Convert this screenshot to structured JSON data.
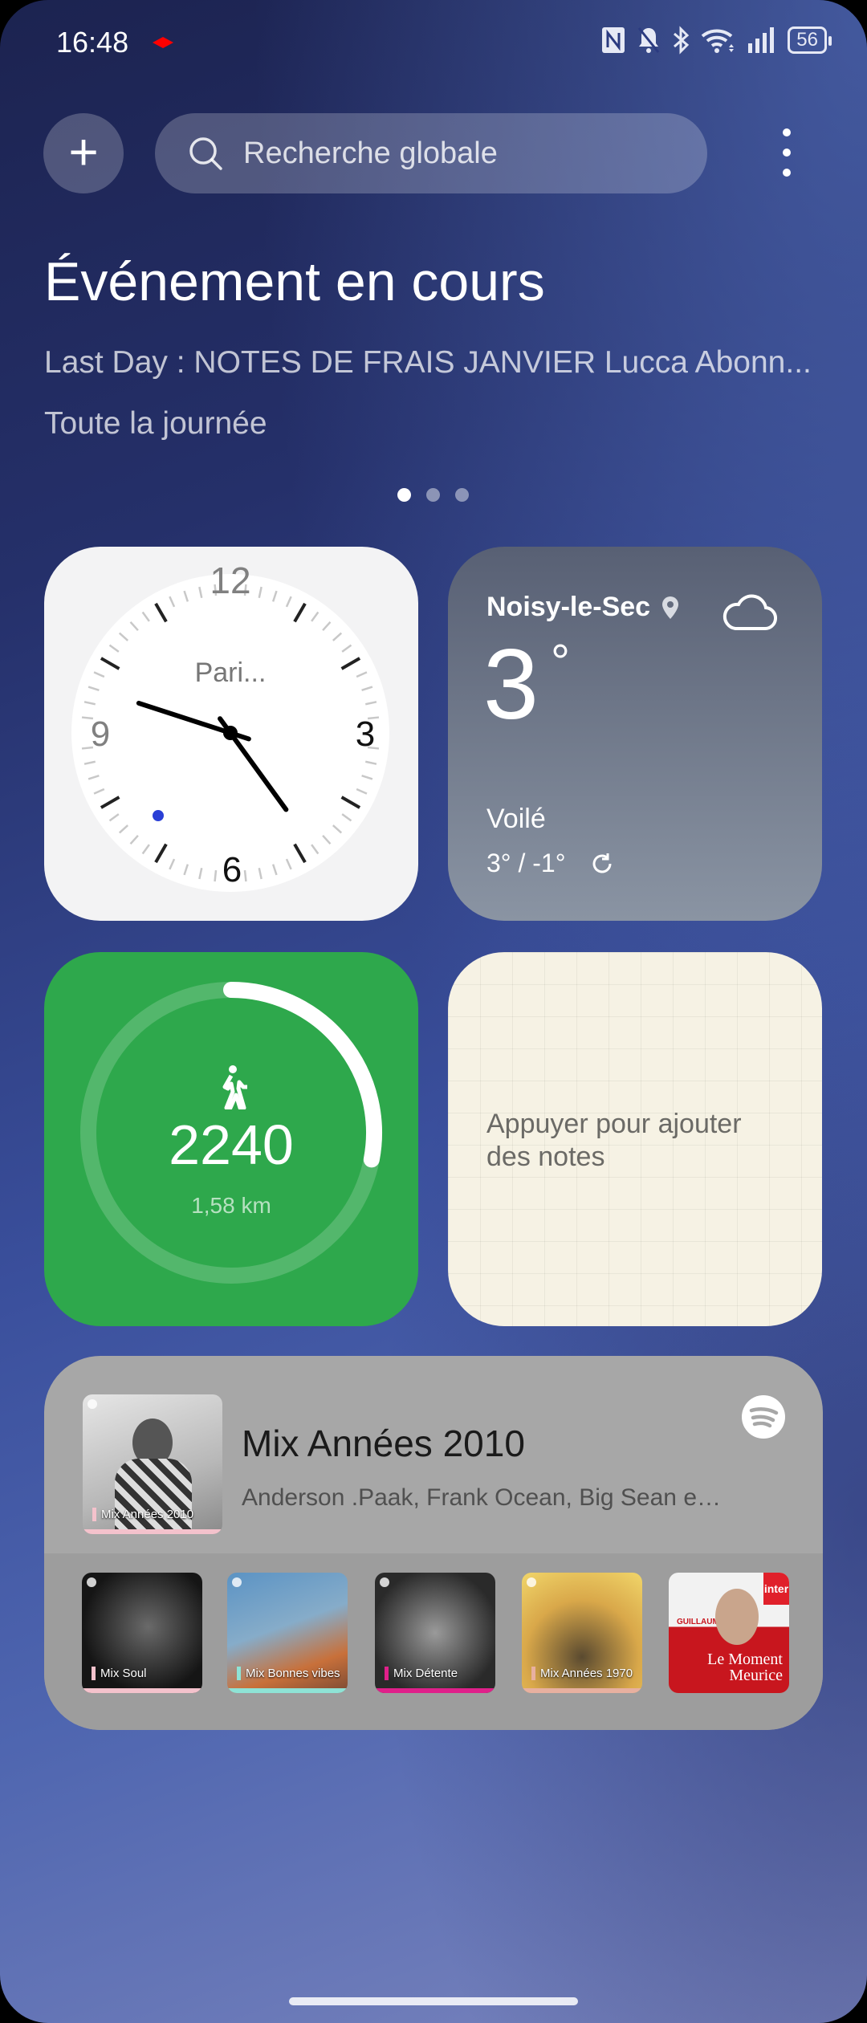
{
  "status_bar": {
    "time": "16:48",
    "battery": "56",
    "icons": [
      "nfc-icon",
      "bell-off-icon",
      "bluetooth-icon",
      "wifi-icon",
      "signal-icon",
      "battery-icon"
    ]
  },
  "search": {
    "placeholder": "Recherche globale"
  },
  "event": {
    "title": "Événement en cours",
    "summary": "Last Day : NOTES DE FRAIS JANVIER Lucca Abonn...",
    "time": "Toute la journée"
  },
  "pager": {
    "pages": 3,
    "current": 0
  },
  "clock": {
    "city": "Pari...",
    "time": "16:48",
    "numerals": [
      "12",
      "3",
      "6",
      "9"
    ]
  },
  "weather": {
    "city": "Noisy-le-Sec",
    "temp": "3",
    "degree": "°",
    "condition": "Voilé",
    "range": "3° / -1°",
    "icon": "cloud-icon"
  },
  "steps": {
    "count": "2240",
    "distance": "1,58 km",
    "progress": 0.28
  },
  "notes": {
    "placeholder": "Appuyer pour ajouter des notes"
  },
  "spotify": {
    "now": {
      "title": "Mix Années 2010",
      "artists": "Anderson .Paak, Frank Ocean, Big Sean et b...",
      "art_label": "Mix Années 2010",
      "accent": "#f4c2cc"
    },
    "items": [
      {
        "label": "Mix Soul",
        "accent": "#f4c2cc"
      },
      {
        "label": "Mix Bonnes vibes",
        "accent": "#8ee3d6"
      },
      {
        "label": "Mix Détente",
        "accent": "#e0208a"
      },
      {
        "label": "Mix Années 1970",
        "accent": "#e8b0a0"
      },
      {
        "label": "Le Moment Meurice",
        "extra": "GUILLAUME MEURICE",
        "brand": "inter",
        "accent": "#d8202a"
      }
    ]
  },
  "colors": {
    "steps_green": "#2ea84c",
    "second_dot": "#2a3fd6"
  }
}
